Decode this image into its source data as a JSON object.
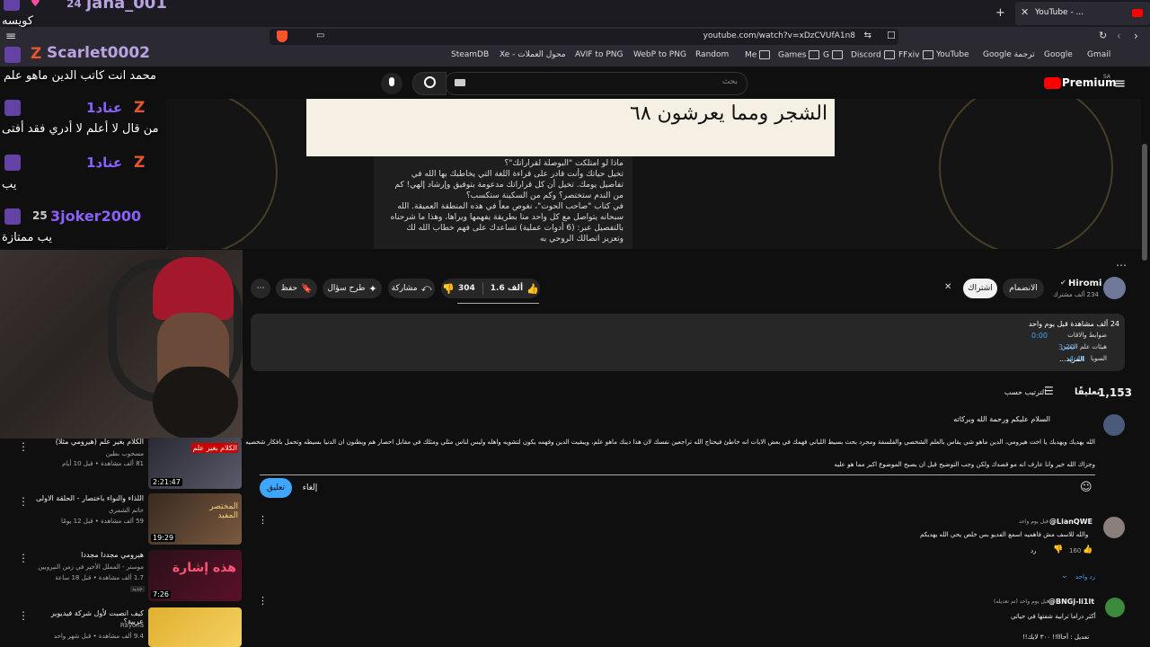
{
  "browser": {
    "tab_title": "YouTube - ...",
    "url": "youtube.com/watch?v=xDzCVUfA1n8",
    "bookmarks": [
      "SteamDB",
      "Xe - محول العملات",
      "AVIF to PNG",
      "WebP to PNG",
      "Random",
      "Me",
      "Games",
      "G",
      "Discord",
      "FFxiv",
      "YouTube",
      "Google ترجمة",
      "Google",
      "Gmail"
    ]
  },
  "youtube": {
    "logo_text": "Premium",
    "logo_region": "SA",
    "search_placeholder": "بحث"
  },
  "chat": [
    {
      "user": "jana_001",
      "badge": "24",
      "message": "كويسه",
      "user_color": "#b9a3e3"
    },
    {
      "user": "Scarlet0002",
      "message": "محمد انت كاتب الدين ماهو علم",
      "user_color": "#b9a3e3"
    },
    {
      "user": "عناد1",
      "message": "من قال لا أعلم لا أدري فقد أفتى",
      "user_color": "#8a60ff"
    },
    {
      "user": "عناد1",
      "message": "يب",
      "user_color": "#8a60ff"
    },
    {
      "user": "3joker2000",
      "badge": "25",
      "message": "يب ممتازة",
      "user_color": "#8a60ff"
    }
  ],
  "video_text": {
    "ayah": "الشجر ومما يعرشون ٦٨",
    "desc_lines": [
      "ماذا لو امتلكت \"البوصلة لقراراتك\"؟",
      "تخيل حياتك وأنت قادر على قراءة اللغة التي يخاطبك بها الله في",
      "تفاصيل يومك. تخيل أن كل قراراتك مدعومة بتوفيق وإرشاد إلهي! كم",
      "من الندم ستختصر؟ وكم من السكينة ستكسب؟",
      "في كتاب \"صاحب الحوت\"، نغوص معاً في هذه المنطقة العميقة. الله",
      "سبحانه يتواصل مع كل واحد منا بطريقة يفهمها ويراها، وهذا ما شرحناه",
      "بالتفصيل عبر: (6 أدوات عملية) تساعدك على فهم خطاب الله لك",
      "وتعزيز اتصالك الروحي به"
    ]
  },
  "channel": {
    "name": "Hiromi",
    "subscribers": "234 ألف مشترك",
    "join_label": "الانضمام",
    "subscribe_label": "اشتراك"
  },
  "actions": {
    "like_count": "1.6 ألف",
    "dislike_count": "304",
    "share_label": "مشاركة",
    "ask_label": "طرح سؤال",
    "save_label": "حفظ"
  },
  "description": {
    "stats": "24 ألف مشاهدة  قبل يوم واحد",
    "chapters": [
      {
        "title": "ضوابط والاقات",
        "time": "0:00"
      },
      {
        "title": "هيئات علم النفس",
        "time": "3:20"
      },
      {
        "title": "السويا",
        "time": "4:44"
      }
    ],
    "more": "...المزيد"
  },
  "comments_header": {
    "count": "1,153",
    "label": "تعليقًا",
    "sort_label": "الترتيب حسب"
  },
  "draft_comment": {
    "line1": "السلام عليكم ورحمة الله وبركاته",
    "line2": "الله يهديك ويهديك يا اخت هيرومي، الدين ماهو شي يقاس بالعلم الشخصي والفلسفة ومجرد بحث بسيط اللباني فهمك في بعض الايات انه خاطئ فيحتاج الله تراجعين نفسك لان هذا دينك ماهو علم، ويبقيت الدين وفهمه يكون لتشويه واهله وليس لناس مثلي ومثلك في مقابل احصار هم ويظنون ان الدنيا بسيطه وتحمل بافكار شخصيه",
    "line3": "وجزاك الله خير وانا عارف انه مو قصدك ولكن وجب التوضيح قبل ان يصبح الموضوع اكبر مما هو عليه",
    "submit": "تعليق",
    "cancel": "إلغاء"
  },
  "comments": [
    {
      "user": "@LianQWE",
      "time": "قبل يوم واحد",
      "text": "والله للاسف مش فاهميه اسمع الفديو بس خلص يحي الله يهديكم",
      "likes": "160",
      "reply": "رد",
      "replies": "رد واحد"
    },
    {
      "user": "@BNGj-li1lt",
      "time": "قبل يوم واحد (تم تعديله)",
      "text": "أكثر دراما ترابية شفتها في حياتي",
      "text2": "تعديل : أحااا!! ٣٠٠ لايك!!"
    }
  ],
  "sidebar_videos": [
    {
      "title": "الكلام بغير علم (هيرومي مثلا)",
      "channel": "مسحوب بطين",
      "meta": "81 ألف مشاهدة • قبل 10 أيام",
      "duration": "2:21:47",
      "thumb_text": "الكلام بغير علم"
    },
    {
      "title": "اللذاء والنواء باختصار - الحلقة الاولى",
      "channel": "حاتم الشمري",
      "meta": "59 ألف مشاهدة • قبل 12 يومًا",
      "duration": "19:29",
      "thumb_text": "المختصر المفيد"
    },
    {
      "title": "هيرومي مجددا مجددا",
      "channel": "موستر - المملل الأخير في زمن النيروبين",
      "meta": "1.7 ألف مشاهدة • قبل 18 ساعة",
      "badge": "جديد",
      "duration": "7:26",
      "thumb_text": "هذه إشارة"
    },
    {
      "title": "كيف انصبت لأول شركة فيديوير عربية؟",
      "channel": "Rayona",
      "meta": "9.4 ألف مشاهدة • قبل شهر واحد",
      "duration": "",
      "thumb_text": ""
    }
  ],
  "colors": {
    "accent": "#3ea6ff",
    "twitch": "#6441a5",
    "red": "#ff0000"
  }
}
